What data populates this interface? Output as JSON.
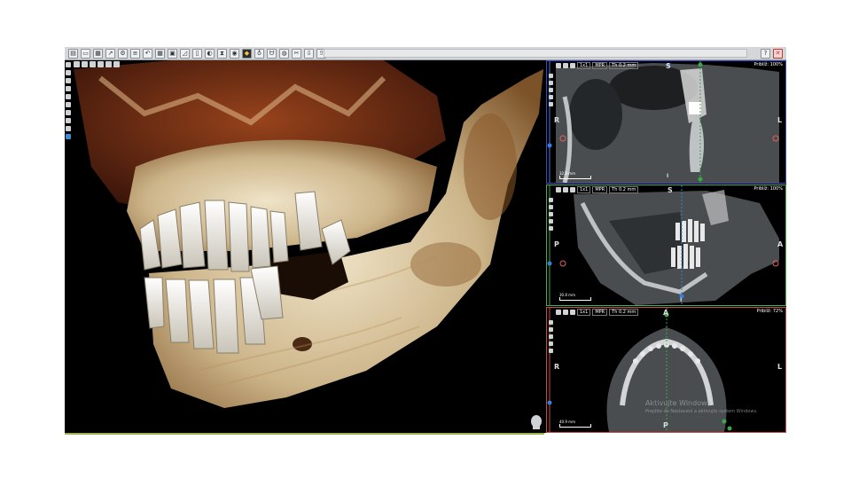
{
  "toolbar": {
    "status_text": "",
    "help_label": "?",
    "close_label": "✕",
    "icons": [
      "open-icon",
      "save-icon",
      "print-icon",
      "export-icon",
      "settings-icon",
      "list-icon",
      "undo-icon",
      "grid-icon",
      "layout-icon",
      "ruler-icon",
      "document-icon",
      "measure-icon",
      "hourglass-icon",
      "nerve-icon",
      "layers-icon",
      "implant-icon",
      "tooth-icon",
      "cut-icon",
      "scissors-icon",
      "download-icon",
      "upload-icon"
    ]
  },
  "viewport3d": {
    "info_line1": "",
    "info_line2": ""
  },
  "panels": {
    "coronal": {
      "tools": {
        "zoom": "1x1",
        "mode": "MPR",
        "thickness": "Th 0.2 mm"
      },
      "info": [
        "",
        "",
        "Priblíž: 100%"
      ],
      "labels": {
        "top": "S",
        "left": "R",
        "right": "L",
        "bottom": "I"
      },
      "scale": "32.8 mm"
    },
    "sagittal": {
      "tools": {
        "zoom": "1x1",
        "mode": "MPR",
        "thickness": "Th 0.2 mm"
      },
      "info": [
        "",
        "",
        "Priblíž: 100%"
      ],
      "labels": {
        "top": "S",
        "left": "P",
        "right": "A",
        "bottom": "I"
      },
      "scale": "30.8 mm"
    },
    "axial": {
      "tools": {
        "zoom": "1x1",
        "mode": "MPR",
        "thickness": "Th 0.2 mm"
      },
      "info": [
        "",
        "",
        "Priblíž: 72%"
      ],
      "labels": {
        "top": "A",
        "left": "R",
        "right": "L",
        "bottom": "P"
      },
      "scale": "40.9 mm"
    }
  },
  "watermark": {
    "title": "Aktivujte Windows",
    "subtitle": "Prejdite do Nastavení a aktivujte systém Windows."
  },
  "colors": {
    "coronal_frame": "#3a49c8",
    "sagittal_frame": "#4ab04a",
    "axial_frame": "#c84a4a",
    "bone": "#e8dcc0",
    "tissue": "#7a2e12"
  }
}
